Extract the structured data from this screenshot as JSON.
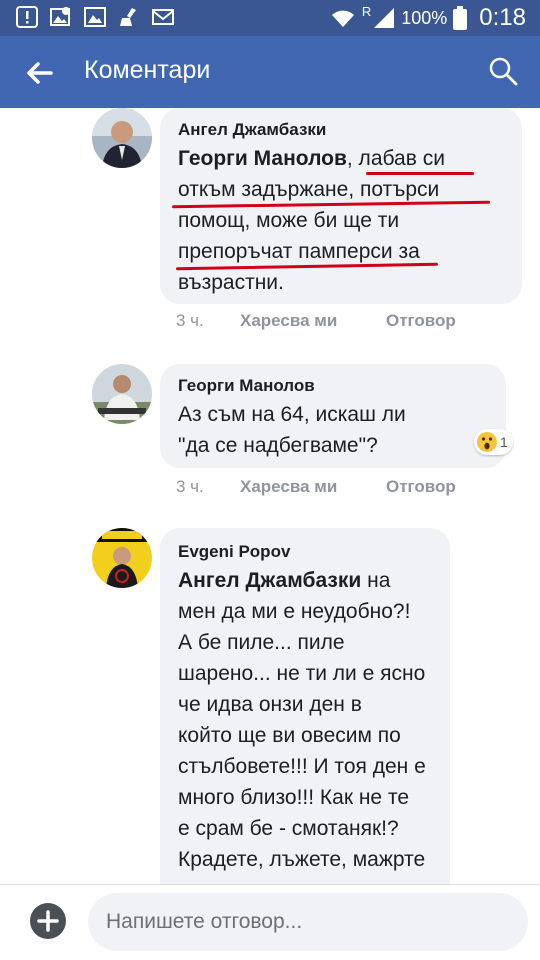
{
  "status_bar": {
    "battery_text": "100%",
    "time": "0:18",
    "network_label": "R",
    "icons": [
      "alert-icon",
      "image-notification-icon",
      "gallery-icon",
      "cleaner-icon",
      "mail-icon",
      "wifi-icon",
      "signal-icon",
      "battery-icon"
    ]
  },
  "header": {
    "title": "Коментари",
    "back_icon": "back-arrow-icon",
    "search_icon": "search-icon",
    "color": "#4267b2"
  },
  "comments": [
    {
      "author": "Ангел Джамбазки",
      "mention": "Георги Манолов",
      "lines": [
        ", лабав си",
        "откъм задържане, потърси",
        "помощ, може би ще ти",
        "препоръчат памперси за",
        "възрастни."
      ],
      "time": "3 ч.",
      "like_label": "Харесва ми",
      "reply_label": "Отговор"
    },
    {
      "author": "Георги Манолов",
      "lines": [
        "Аз съм на 64, искаш ли",
        "\"да се надбегваме\"?"
      ],
      "reaction_count": "1",
      "reaction_icon": "wow-reaction-icon",
      "time": "3 ч.",
      "like_label": "Харесва ми",
      "reply_label": "Отговор"
    },
    {
      "author": "Evgeni Popov",
      "mention": "Ангел Джамбазки",
      "lines": [
        " на",
        "мен да ми е неудобно?!",
        "А бе пиле... пиле",
        "шарено... не ти ли е ясно",
        "че идва онзи ден в",
        "който ще ви овесим по",
        "стълбовете!!! И тоя ден е",
        "много близо!!! Как не те",
        "е срам бе - смотаняк!?",
        "Крадете, лъжете, мажрте"
      ]
    }
  ],
  "footer": {
    "placeholder": "Напишете отговор...",
    "add_icon": "plus-icon"
  },
  "colors": {
    "status_bar": "#3a5793",
    "header": "#4267b2",
    "bubble": "#f1f2f5",
    "underline": "#d0021b",
    "meta_text": "#90949c"
  }
}
